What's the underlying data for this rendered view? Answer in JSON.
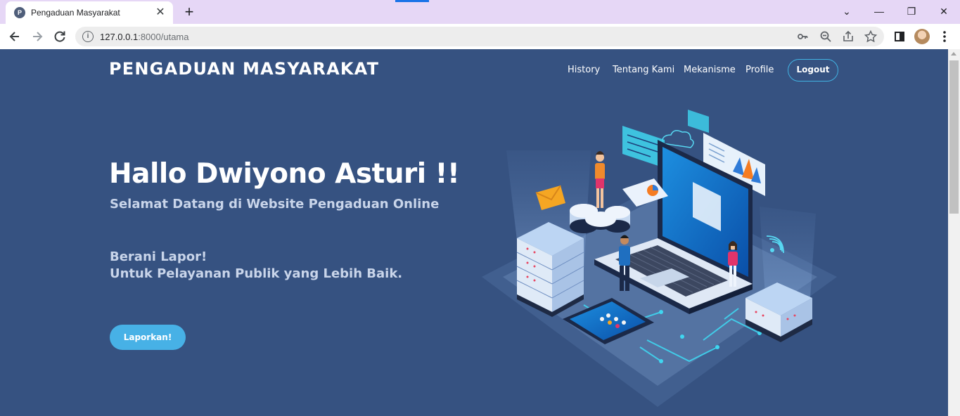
{
  "browser": {
    "tab_title": "Pengaduan Masyarakat",
    "tab_close": "✕",
    "new_tab": "+",
    "url_host": "127.0.0.1",
    "url_rest": ":8000/utama",
    "window_controls": {
      "tabs_menu": "⌄",
      "minimize": "—",
      "restore": "❐",
      "close": "✕"
    },
    "icons": [
      "back-icon",
      "forward-icon",
      "reload-icon",
      "info-icon",
      "key-icon",
      "zoom-icon",
      "share-icon",
      "star-icon",
      "sidepanel-icon",
      "avatar",
      "menu-icon"
    ]
  },
  "header": {
    "brand": "PENGADUAN MASYARAKAT",
    "nav": [
      "History",
      "Tentang Kami",
      "Mekanisme",
      "Profile"
    ],
    "logout": "Logout"
  },
  "hero": {
    "title": "Hallo Dwiyono Asturi !!",
    "subtitle": "Selamat Datang di Website Pengaduan Online",
    "line1": "Berani Lapor!",
    "line2": "Untuk Pelayanan Publik yang Lebih Baik.",
    "cta": "Laporkan!"
  },
  "colors": {
    "page_bg": "#365281",
    "accent": "#47b1e6",
    "tabbar_bg": "#e6d7f6"
  }
}
